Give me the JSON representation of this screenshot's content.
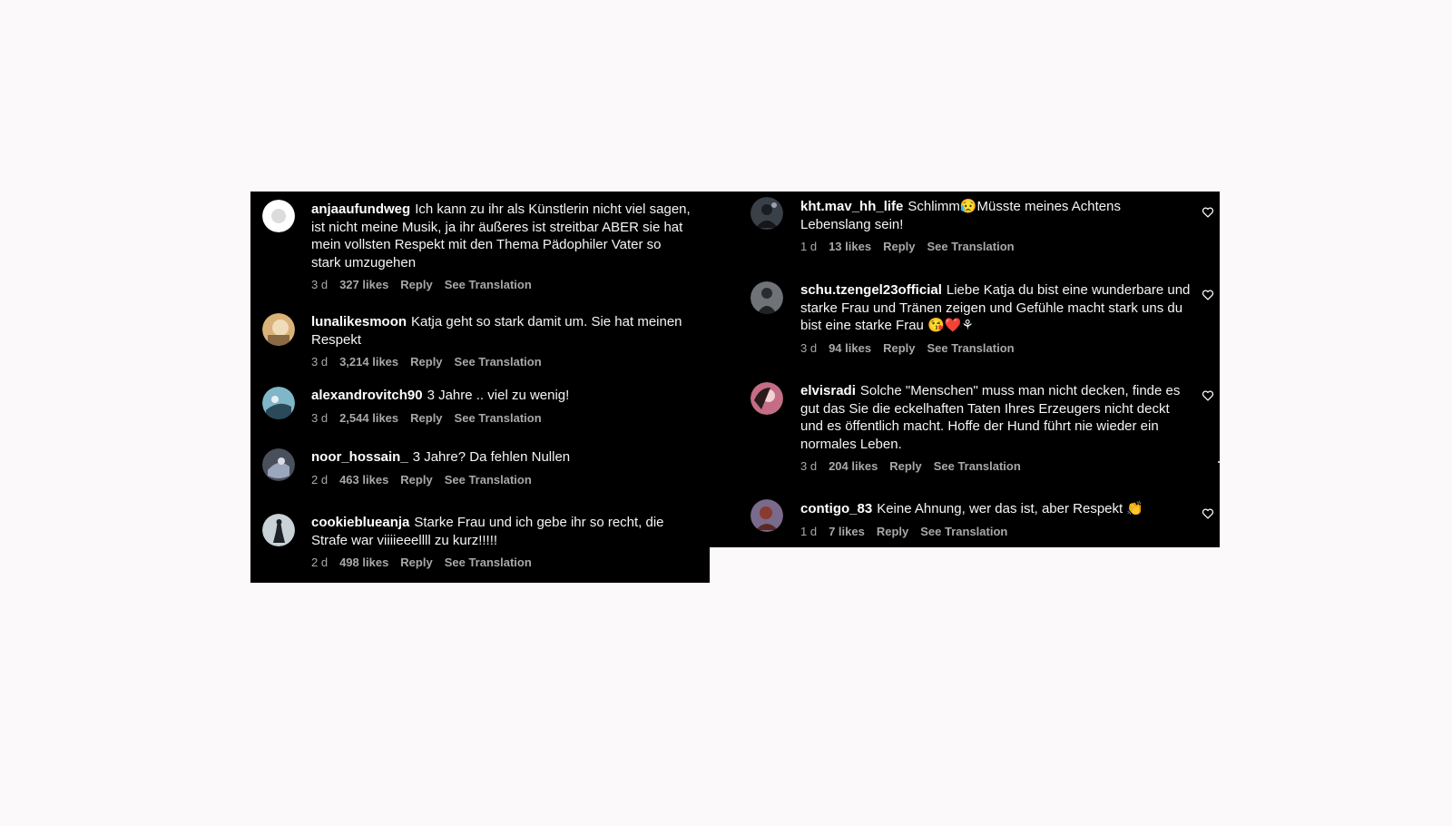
{
  "left_comments": [
    {
      "user": "anjaaufundweg",
      "text": "Ich kann zu ihr als Künstlerin nicht viel sagen, ist nicht meine Musik, ja ihr äußeres ist streitbar ABER sie hat mein vollsten Respekt mit den Thema Pädophiler Vater so stark umzugehen",
      "time": "3 d",
      "likes": "327 likes",
      "reply": "Reply",
      "translate": "See Translation"
    },
    {
      "user": "lunalikesmoon",
      "text": "Katja geht so stark damit um. Sie hat meinen Respekt",
      "time": "3 d",
      "likes": "3,214 likes",
      "reply": "Reply",
      "translate": "See Translation"
    },
    {
      "user": "alexandrovitch90",
      "text": "3 Jahre .. viel zu wenig!",
      "time": "3 d",
      "likes": "2,544 likes",
      "reply": "Reply",
      "translate": "See Translation"
    },
    {
      "user": "noor_hossain_",
      "text": "3 Jahre? Da fehlen Nullen",
      "time": "2 d",
      "likes": "463 likes",
      "reply": "Reply",
      "translate": "See Translation"
    },
    {
      "user": "cookieblueanja",
      "text": "Starke Frau und ich gebe ihr so recht, die Strafe war viiiieeellll zu kurz!!!!!",
      "time": "2 d",
      "likes": "498 likes",
      "reply": "Reply",
      "translate": "See Translation"
    }
  ],
  "right_comments": [
    {
      "user": "kht.mav_hh_life",
      "text": "Schlimm😥Müsste meines Achtens Lebenslang sein!",
      "time": "1 d",
      "likes": "13 likes",
      "reply": "Reply",
      "translate": "See Translation"
    },
    {
      "user": "schu.tzengel23official",
      "text": "Liebe Katja du bist eine wunderbare und starke Frau und Tränen zeigen und Gefühle macht stark uns du bist eine starke Frau 😘❤️⚘",
      "time": "3 d",
      "likes": "94 likes",
      "reply": "Reply",
      "translate": "See Translation"
    },
    {
      "user": "elvisradi",
      "text": "Solche \"Menschen\" muss man nicht decken, finde es gut das Sie die eckelhaften Taten Ihres Erzeugers nicht deckt und es öffentlich macht. Hoffe der Hund führt nie wieder ein normales Leben.",
      "time": "3 d",
      "likes": "204 likes",
      "reply": "Reply",
      "translate": "See Translation"
    },
    {
      "user": "contigo_83",
      "text": "Keine Ahnung, wer das ist, aber Respekt 👏",
      "time": "1 d",
      "likes": "7 likes",
      "reply": "Reply",
      "translate": "See Translation"
    }
  ],
  "icons": {
    "like": "heart-outline-icon",
    "avatar": "profile-photo"
  },
  "colors": {
    "panel_bg": "#000000",
    "page_bg": "#fbf9f9",
    "meta_text": "#a8a8a8"
  }
}
